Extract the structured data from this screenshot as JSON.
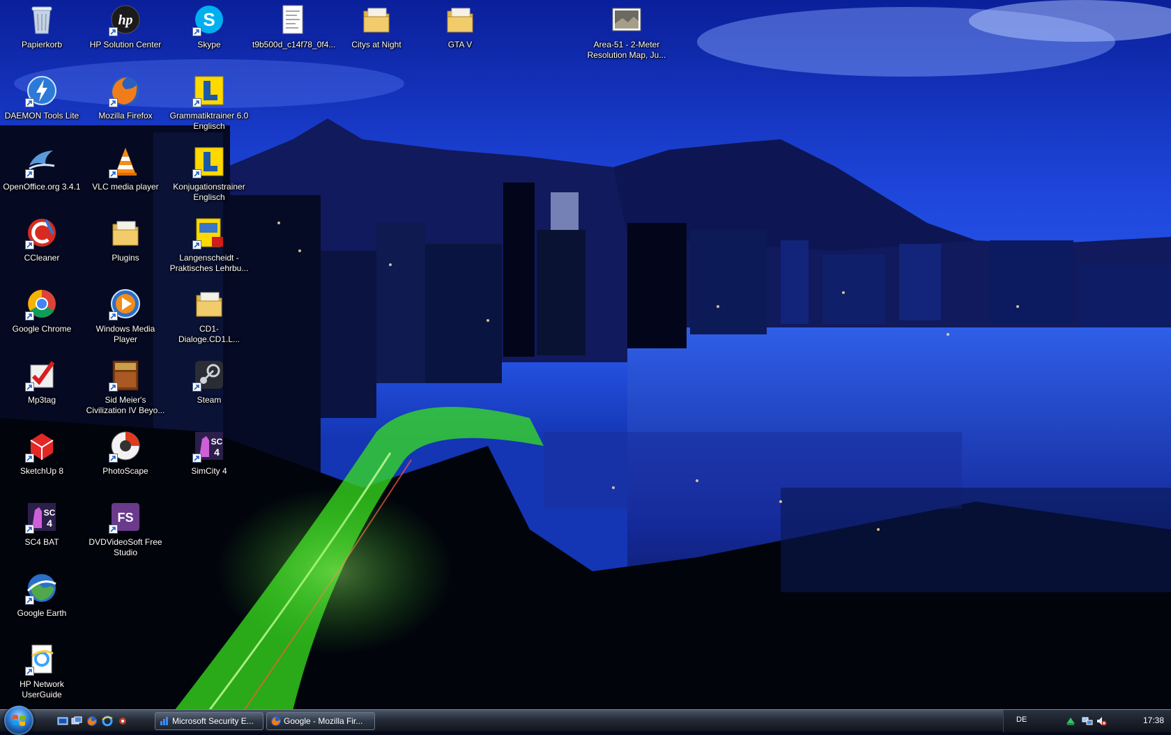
{
  "desktop": {
    "icons": [
      {
        "label": "Papierkorb",
        "icon": "recycle-bin-icon"
      },
      {
        "label": "HP Solution Center",
        "icon": "hp-icon"
      },
      {
        "label": "Skype",
        "icon": "skype-icon"
      },
      {
        "label": "t9b500d_c14f78_0f4...",
        "icon": "document-icon"
      },
      {
        "label": "Citys at Night",
        "icon": "folder-icon"
      },
      {
        "label": "GTA V",
        "icon": "folder-icon"
      },
      {
        "label": "Area-51 - 2-Meter Resolution Map, Ju...",
        "icon": "image-icon"
      },
      {
        "label": "DAEMON Tools Lite",
        "icon": "daemon-tools-icon"
      },
      {
        "label": "Mozilla Firefox",
        "icon": "firefox-icon"
      },
      {
        "label": "Grammatiktrainer 6.0 Englisch",
        "icon": "langenscheidt-icon"
      },
      {
        "label": "OpenOffice.org 3.4.1",
        "icon": "openoffice-icon"
      },
      {
        "label": "VLC media player",
        "icon": "vlc-icon"
      },
      {
        "label": "Konjugationstrainer Englisch",
        "icon": "langenscheidt-icon"
      },
      {
        "label": "CCleaner",
        "icon": "ccleaner-icon"
      },
      {
        "label": "Plugins",
        "icon": "folder-icon"
      },
      {
        "label": "Langenscheidt - Praktisches Lehrbu...",
        "icon": "pdf-book-icon"
      },
      {
        "label": "Google Chrome",
        "icon": "chrome-icon"
      },
      {
        "label": "Windows Media Player",
        "icon": "media-player-icon"
      },
      {
        "label": "CD1-Dialoge.CD1.L...",
        "icon": "folder-icon"
      },
      {
        "label": "Mp3tag",
        "icon": "mp3tag-icon"
      },
      {
        "label": "Sid Meier's Civilization IV Beyo...",
        "icon": "civilization-icon"
      },
      {
        "label": "Steam",
        "icon": "steam-icon"
      },
      {
        "label": "SketchUp 8",
        "icon": "sketchup-icon"
      },
      {
        "label": "PhotoScape",
        "icon": "photoscape-icon"
      },
      {
        "label": "SimCity 4",
        "icon": "simcity-icon"
      },
      {
        "label": "SC4 BAT",
        "icon": "simcity-icon"
      },
      {
        "label": "DVDVideoSoft Free Studio",
        "icon": "dvdvideosoft-icon"
      },
      {
        "label": "Google Earth",
        "icon": "google-earth-icon"
      },
      {
        "label": "HP Network UserGuide",
        "icon": "ie-document-icon"
      }
    ]
  },
  "taskbar": {
    "tasks": [
      {
        "label": "Microsoft Security E...",
        "icon": "security-essentials-icon"
      },
      {
        "label": "Google - Mozilla Fir...",
        "icon": "firefox-icon"
      }
    ],
    "language": "DE",
    "clock": "17:38"
  },
  "colors": {
    "taskbar": "#1d2430",
    "sky_top": "#0a2fb0",
    "sky_bottom": "#2d63f0",
    "road_glow": "#5cff3a"
  }
}
